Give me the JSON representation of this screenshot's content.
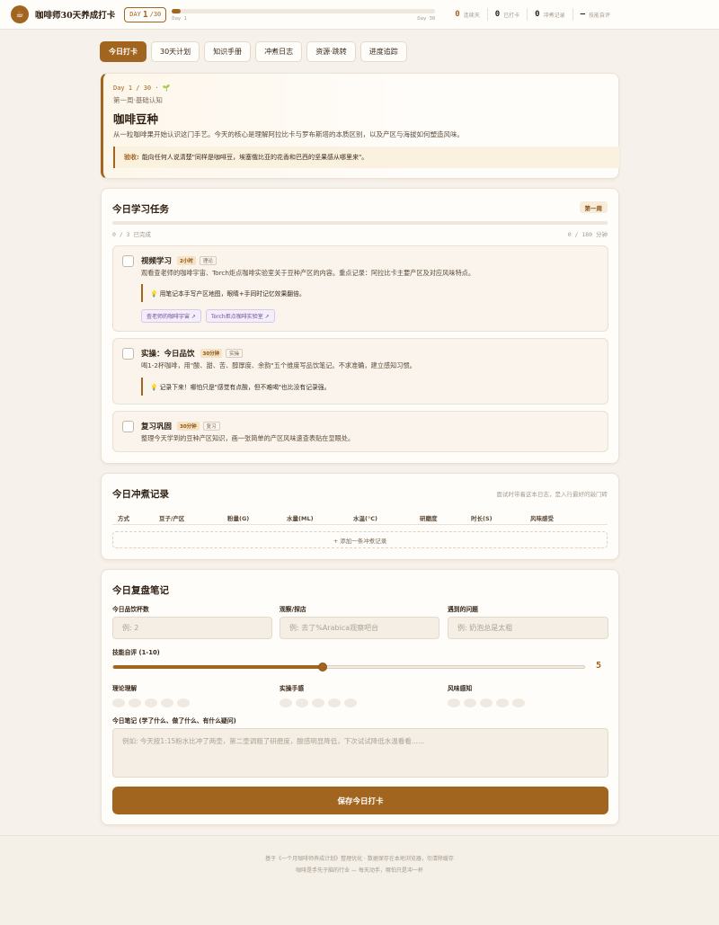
{
  "header": {
    "logo_glyph": "☕",
    "title": "咖啡师30天养成打卡",
    "day_prefix": "DAY",
    "day_current": "1",
    "day_total": "/30",
    "progress_start": "Day 1",
    "progress_end": "Day 30",
    "progress_fraction": 0.033,
    "stats": [
      {
        "value": "0",
        "label": "连续天"
      },
      {
        "value": "0",
        "label": "已打卡"
      },
      {
        "value": "0",
        "label": "冲煮记录"
      },
      {
        "value": "—",
        "label": "技能自评"
      }
    ]
  },
  "tabs": [
    {
      "label": "今日打卡",
      "active": true
    },
    {
      "label": "30天计划",
      "active": false
    },
    {
      "label": "知识手册",
      "active": false
    },
    {
      "label": "冲煮日志",
      "active": false
    },
    {
      "label": "资源·跳转",
      "active": false
    },
    {
      "label": "进度追踪",
      "active": false
    }
  ],
  "day_card": {
    "day_line": "Day 1 / 30 · 🌱",
    "week": "第一周·基础认知",
    "title": "咖啡豆种",
    "desc": "从一粒咖啡果开始认识这门手艺。今天的核心是理解阿拉比卡与罗布斯塔的本质区别，以及产区与海拔如何塑造风味。",
    "accept_label": "验收:",
    "accept_text": "能向任何人说清楚\"同样是咖啡豆，埃塞俄比亚的花香和巴西的坚果感从哪里来\"。"
  },
  "tasks_card": {
    "title": "今日学习任务",
    "week_chip": "第一周",
    "count": "0 / 3 已完成",
    "minutes": "0 / 180 分钟",
    "tasks": [
      {
        "name": "视频学习",
        "time": "2小时",
        "type": "理论",
        "desc": "观看查老师的咖啡宇宙、Torch炬点咖啡实验室关于豆种产区的内容。重点记录：阿拉比卡主要产区及对应风味特点。",
        "tip": "💡 用笔记本手写产区地图，眼睛+手同时记忆效果翻倍。",
        "links": [
          "查老师的咖啡宇宙 ↗",
          "Torch炬点咖啡实验室 ↗"
        ]
      },
      {
        "name": "实操：今日品饮",
        "time": "30分钟",
        "type": "实操",
        "desc": "喝1-2杯咖啡，用\"酸、甜、苦、醇厚度、余韵\"五个维度写品饮笔记。不求准确，建立感知习惯。",
        "tip": "💡 记录下来！哪怕只是\"感觉有点酸，但不难喝\"也比没有记录强。"
      },
      {
        "name": "复习巩固",
        "time": "30分钟",
        "type": "复习",
        "desc": "整理今天学到的豆种产区知识，画一张简单的产区风味速查表贴在显眼处。"
      }
    ]
  },
  "brew_card": {
    "title": "今日冲煮记录",
    "hint": "面试时带着这本日志，是入行最好的敲门砖",
    "columns": [
      "方式",
      "豆子/产区",
      "粉量(G)",
      "水量(ML)",
      "水温(°C)",
      "研磨度",
      "时长(S)",
      "风味感受"
    ],
    "add_row": "+ 添加一条冲煮记录"
  },
  "review_card": {
    "title": "今日复盘笔记",
    "fields": [
      {
        "label": "今日品饮杯数",
        "placeholder": "例: 2"
      },
      {
        "label": "观察/探店",
        "placeholder": "例: 去了%Arabica观察吧台"
      },
      {
        "label": "遇到的问题",
        "placeholder": "例: 奶泡总是太粗"
      }
    ],
    "skill_label": "技能自评 (1-10)",
    "skill_value": "5",
    "skill_fraction": 0.444,
    "ratings": [
      {
        "label": "理论理解"
      },
      {
        "label": "实操手感"
      },
      {
        "label": "风味感知"
      }
    ],
    "notes_label": "今日笔记 (学了什么、做了什么、有什么疑问)",
    "notes_placeholder": "例如: 今天按1:15粉水比冲了两壶，第二壶调粗了研磨度，酸感明显降低，下次试试降低水温看看......",
    "save": "保存今日打卡"
  },
  "footer": {
    "line1": "基于《一个月咖啡师养成计划》整理优化 · 数据保存在本地浏览器，勿清除缓存",
    "line2": "咖啡是手先于脑的行业 — 每天动手，哪怕只是冲一杯"
  },
  "colors": {
    "accent": "#a2651f",
    "background": "#f6f1ea",
    "card": "#fffdfa"
  }
}
